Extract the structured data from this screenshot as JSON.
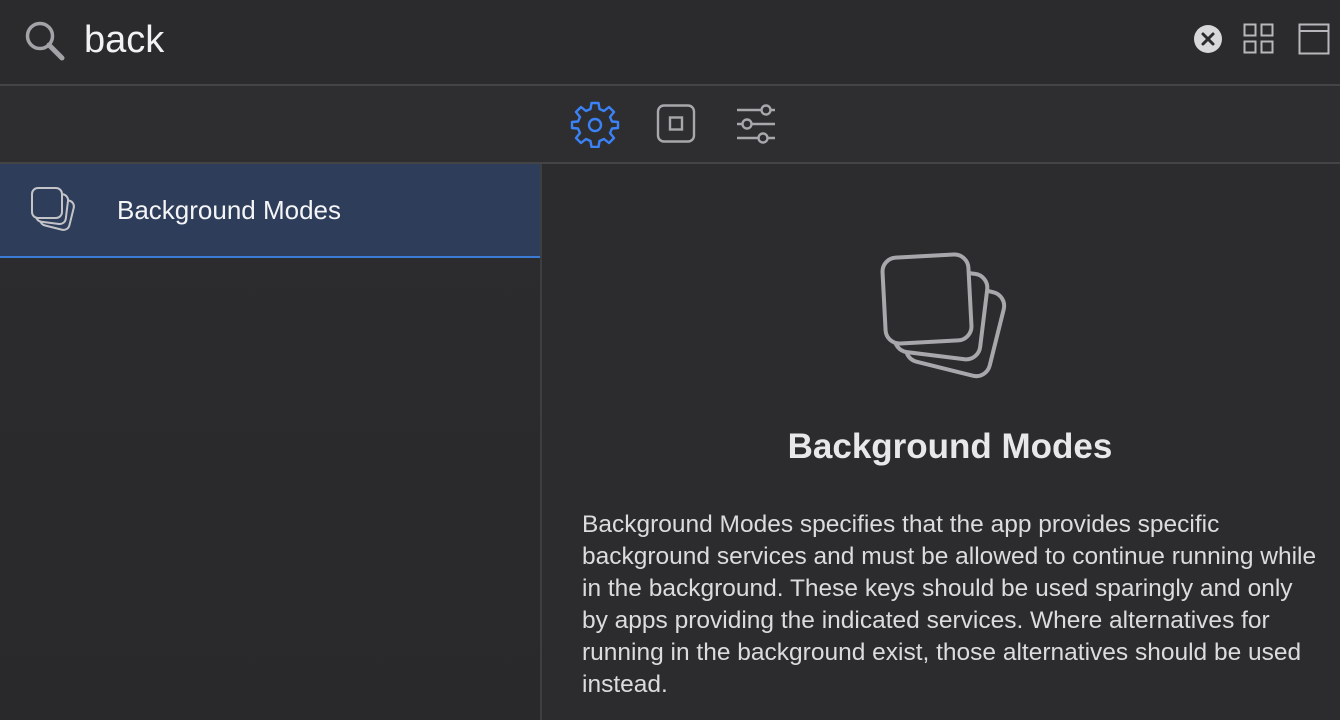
{
  "search": {
    "value": "back",
    "placeholder": ""
  },
  "icons": {
    "search": "search-icon",
    "clear": "clear-circle-icon",
    "grid_view": "grid-view-icon",
    "list_view": "single-pane-view-icon",
    "gear": "gear-icon",
    "object": "object-square-icon",
    "settings": "sliders-icon",
    "capability": "stacked-cards-icon"
  },
  "colors": {
    "accent": "#3a7bd5",
    "selection": "#2d3d5a",
    "background": "#2b2b2d"
  },
  "list": {
    "items": [
      {
        "label": "Background Modes",
        "selected": true
      }
    ]
  },
  "detail": {
    "title": "Background Modes",
    "description": "Background Modes specifies that the app provides specific background services and must be allowed to continue running while in the background. These keys should be used sparingly and only by apps providing the indicated services. Where alternatives for running in the background exist, those alternatives should be used instead."
  }
}
